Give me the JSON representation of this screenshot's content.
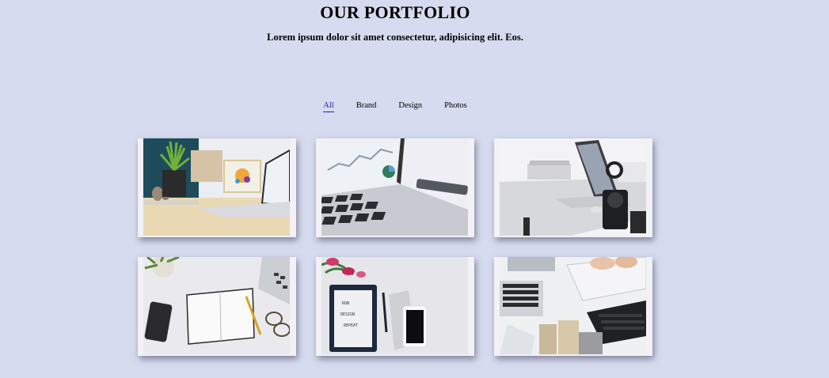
{
  "header": {
    "title": "OUR PORTFOLIO",
    "subtitle": "Lorem ipsum dolor sit amet consectetur, adipisicing elit. Eos."
  },
  "filters": [
    {
      "label": "All",
      "active": true
    },
    {
      "label": "Brand",
      "active": false
    },
    {
      "label": "Design",
      "active": false
    },
    {
      "label": "Photos",
      "active": false
    }
  ],
  "portfolio": {
    "items": [
      {
        "icon": "desk-plant-laptop-photo"
      },
      {
        "icon": "laptop-keyboard-chart-photo"
      },
      {
        "icon": "laptop-desk-camera-photo"
      },
      {
        "icon": "notebook-phone-glasses-photo"
      },
      {
        "icon": "notepad-phone-flowers-photo"
      },
      {
        "icon": "keyboard-laptop-workspace-photo"
      }
    ]
  },
  "colors": {
    "background": "#d7dbef",
    "active_filter": "#1e1ea8",
    "card_frame": "#f1f1f6"
  }
}
